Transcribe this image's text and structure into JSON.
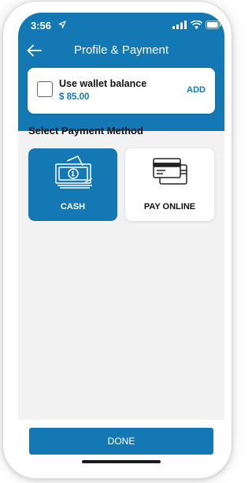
{
  "status_bar": {
    "time": "3:56",
    "icons": [
      "location-arrow-icon",
      "signal-icon",
      "wifi-icon",
      "battery-icon"
    ]
  },
  "header": {
    "title": "Profile & Payment",
    "back_icon": "arrow-left-icon",
    "color": "#1478b4"
  },
  "wallet": {
    "label": "Use wallet balance",
    "amount": "$ 85.00",
    "add_label": "ADD",
    "checked": false
  },
  "payment": {
    "section_title": "Select Payment Method",
    "options": [
      {
        "label": "CASH",
        "icon": "cash-icon",
        "selected": true
      },
      {
        "label": "PAY ONLINE",
        "icon": "credit-card-icon",
        "selected": false
      }
    ]
  },
  "footer": {
    "done_label": "DONE"
  },
  "colors": {
    "accent": "#1478b4",
    "background": "#f2f2f2",
    "card": "#ffffff"
  }
}
